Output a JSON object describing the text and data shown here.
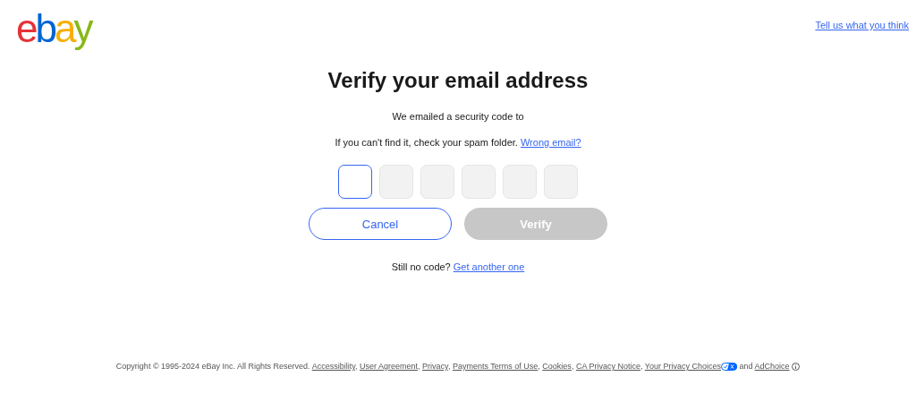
{
  "header": {
    "logo": [
      {
        "letter": "e",
        "color": "#e53238"
      },
      {
        "letter": "b",
        "color": "#0064d2"
      },
      {
        "letter": "a",
        "color": "#f5af02"
      },
      {
        "letter": "y",
        "color": "#86b817"
      }
    ],
    "feedback_link": "Tell us what you think"
  },
  "title": "Verify your email address",
  "message": "We emailed a security code to",
  "spam_note": {
    "text": "If you can't find it, check your spam folder.",
    "link": "Wrong email?"
  },
  "code_boxes": [
    {
      "focused": true
    },
    {
      "focused": false
    },
    {
      "focused": false
    },
    {
      "focused": false
    },
    {
      "focused": false
    },
    {
      "focused": false
    }
  ],
  "buttons": [
    {
      "label": "Cancel",
      "kind": "secondary",
      "disabled": false
    },
    {
      "label": "Verify",
      "kind": "primary",
      "disabled": true
    }
  ],
  "resend": {
    "text": "Still no code?",
    "link": "Get another one"
  },
  "footer": [
    {
      "kind": "text",
      "text": "Copyright © 1995-2024 eBay Inc. All Rights Reserved."
    },
    {
      "kind": "link",
      "text": "Accessibility"
    },
    {
      "kind": "text",
      "text": ","
    },
    {
      "kind": "link",
      "text": "User Agreement"
    },
    {
      "kind": "text",
      "text": ","
    },
    {
      "kind": "link",
      "text": "Privacy"
    },
    {
      "kind": "text",
      "text": ","
    },
    {
      "kind": "link",
      "text": "Payments Terms of Use"
    },
    {
      "kind": "text",
      "text": ","
    },
    {
      "kind": "link",
      "text": "Cookies"
    },
    {
      "kind": "text",
      "text": ","
    },
    {
      "kind": "link",
      "text": "CA Privacy Notice"
    },
    {
      "kind": "text",
      "text": ","
    },
    {
      "kind": "link",
      "text": "Your Privacy Choices"
    },
    {
      "kind": "toggle-icon"
    },
    {
      "kind": "text",
      "text": "and"
    },
    {
      "kind": "link",
      "text": "AdChoice"
    },
    {
      "kind": "info-icon"
    }
  ]
}
